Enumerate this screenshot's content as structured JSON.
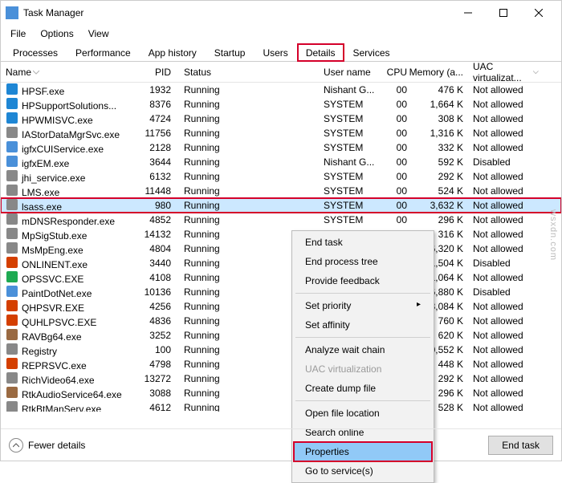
{
  "window": {
    "title": "Task Manager"
  },
  "menu": {
    "file": "File",
    "options": "Options",
    "view": "View"
  },
  "tabs": {
    "processes": "Processes",
    "performance": "Performance",
    "apphistory": "App history",
    "startup": "Startup",
    "users": "Users",
    "details": "Details",
    "services": "Services",
    "active": "details"
  },
  "columns": {
    "name": "Name",
    "pid": "PID",
    "status": "Status",
    "user": "User name",
    "cpu": "CPU",
    "mem": "Memory (a...",
    "uac": "UAC virtualizat..."
  },
  "rows": [
    {
      "name": "HPSF.exe",
      "pid": "1932",
      "status": "Running",
      "user": "Nishant G...",
      "cpu": "00",
      "mem": "476 K",
      "uac": "Not allowed",
      "col": "#1e86d4"
    },
    {
      "name": "HPSupportSolutions...",
      "pid": "8376",
      "status": "Running",
      "user": "SYSTEM",
      "cpu": "00",
      "mem": "1,664 K",
      "uac": "Not allowed",
      "col": "#1e86d4"
    },
    {
      "name": "HPWMISVC.exe",
      "pid": "4724",
      "status": "Running",
      "user": "SYSTEM",
      "cpu": "00",
      "mem": "308 K",
      "uac": "Not allowed",
      "col": "#1e86d4"
    },
    {
      "name": "IAStorDataMgrSvc.exe",
      "pid": "11756",
      "status": "Running",
      "user": "SYSTEM",
      "cpu": "00",
      "mem": "1,316 K",
      "uac": "Not allowed",
      "col": "#888"
    },
    {
      "name": "igfxCUIService.exe",
      "pid": "2128",
      "status": "Running",
      "user": "SYSTEM",
      "cpu": "00",
      "mem": "332 K",
      "uac": "Not allowed",
      "col": "#4a90d9"
    },
    {
      "name": "igfxEM.exe",
      "pid": "3644",
      "status": "Running",
      "user": "Nishant G...",
      "cpu": "00",
      "mem": "592 K",
      "uac": "Disabled",
      "col": "#4a90d9"
    },
    {
      "name": "jhi_service.exe",
      "pid": "6132",
      "status": "Running",
      "user": "SYSTEM",
      "cpu": "00",
      "mem": "292 K",
      "uac": "Not allowed",
      "col": "#888"
    },
    {
      "name": "LMS.exe",
      "pid": "11448",
      "status": "Running",
      "user": "SYSTEM",
      "cpu": "00",
      "mem": "524 K",
      "uac": "Not allowed",
      "col": "#888"
    },
    {
      "name": "lsass.exe",
      "pid": "980",
      "status": "Running",
      "user": "SYSTEM",
      "cpu": "00",
      "mem": "3,632 K",
      "uac": "Not allowed",
      "col": "#888",
      "sel": true
    },
    {
      "name": "mDNSResponder.exe",
      "pid": "4852",
      "status": "Running",
      "user": "SYSTEM",
      "cpu": "00",
      "mem": "296 K",
      "uac": "Not allowed",
      "col": "#888"
    },
    {
      "name": "MpSigStub.exe",
      "pid": "14132",
      "status": "Running",
      "user": "",
      "cpu": "",
      "mem": "316 K",
      "uac": "Not allowed",
      "col": "#888"
    },
    {
      "name": "MsMpEng.exe",
      "pid": "4804",
      "status": "Running",
      "user": "",
      "cpu": "",
      "mem": "6,320 K",
      "uac": "Not allowed",
      "col": "#888"
    },
    {
      "name": "ONLINENT.exe",
      "pid": "3440",
      "status": "Running",
      "user": "",
      "cpu": "",
      "mem": "1,504 K",
      "uac": "Disabled",
      "col": "#d43f00"
    },
    {
      "name": "OPSSVC.EXE",
      "pid": "4108",
      "status": "Running",
      "user": "",
      "cpu": "",
      "mem": "1,064 K",
      "uac": "Not allowed",
      "col": "#1eaa52"
    },
    {
      "name": "PaintDotNet.exe",
      "pid": "10136",
      "status": "Running",
      "user": "",
      "cpu": "",
      "mem": "36,880 K",
      "uac": "Disabled",
      "col": "#4a90d9"
    },
    {
      "name": "QHPSVR.EXE",
      "pid": "4256",
      "status": "Running",
      "user": "",
      "cpu": "",
      "mem": "3,084 K",
      "uac": "Not allowed",
      "col": "#d43f00"
    },
    {
      "name": "QUHLPSVC.EXE",
      "pid": "4836",
      "status": "Running",
      "user": "",
      "cpu": "",
      "mem": "760 K",
      "uac": "Not allowed",
      "col": "#d43f00"
    },
    {
      "name": "RAVBg64.exe",
      "pid": "3252",
      "status": "Running",
      "user": "",
      "cpu": "",
      "mem": "620 K",
      "uac": "Not allowed",
      "col": "#9a6a42"
    },
    {
      "name": "Registry",
      "pid": "100",
      "status": "Running",
      "user": "",
      "cpu": "",
      "mem": "10,552 K",
      "uac": "Not allowed",
      "col": "#888"
    },
    {
      "name": "REPRSVC.exe",
      "pid": "4798",
      "status": "Running",
      "user": "",
      "cpu": "",
      "mem": "448 K",
      "uac": "Not allowed",
      "col": "#d43f00"
    },
    {
      "name": "RichVideo64.exe",
      "pid": "13272",
      "status": "Running",
      "user": "",
      "cpu": "",
      "mem": "292 K",
      "uac": "Not allowed",
      "col": "#888"
    },
    {
      "name": "RtkAudioService64.exe",
      "pid": "3088",
      "status": "Running",
      "user": "",
      "cpu": "",
      "mem": "296 K",
      "uac": "Not allowed",
      "col": "#9a6a42"
    },
    {
      "name": "RtkBtManServ.exe",
      "pid": "4612",
      "status": "Running",
      "user": "",
      "cpu": "",
      "mem": "528 K",
      "uac": "Not allowed",
      "col": "#888"
    }
  ],
  "context": {
    "endtask": "End task",
    "endtree": "End process tree",
    "feedback": "Provide feedback",
    "priority": "Set priority",
    "affinity": "Set affinity",
    "analyze": "Analyze wait chain",
    "uacvirt": "UAC virtualization",
    "dump": "Create dump file",
    "openloc": "Open file location",
    "search": "Search online",
    "properties": "Properties",
    "goservice": "Go to service(s)"
  },
  "footer": {
    "fewer": "Fewer details",
    "endtask": "End task"
  },
  "watermark": "wsxdn.com"
}
